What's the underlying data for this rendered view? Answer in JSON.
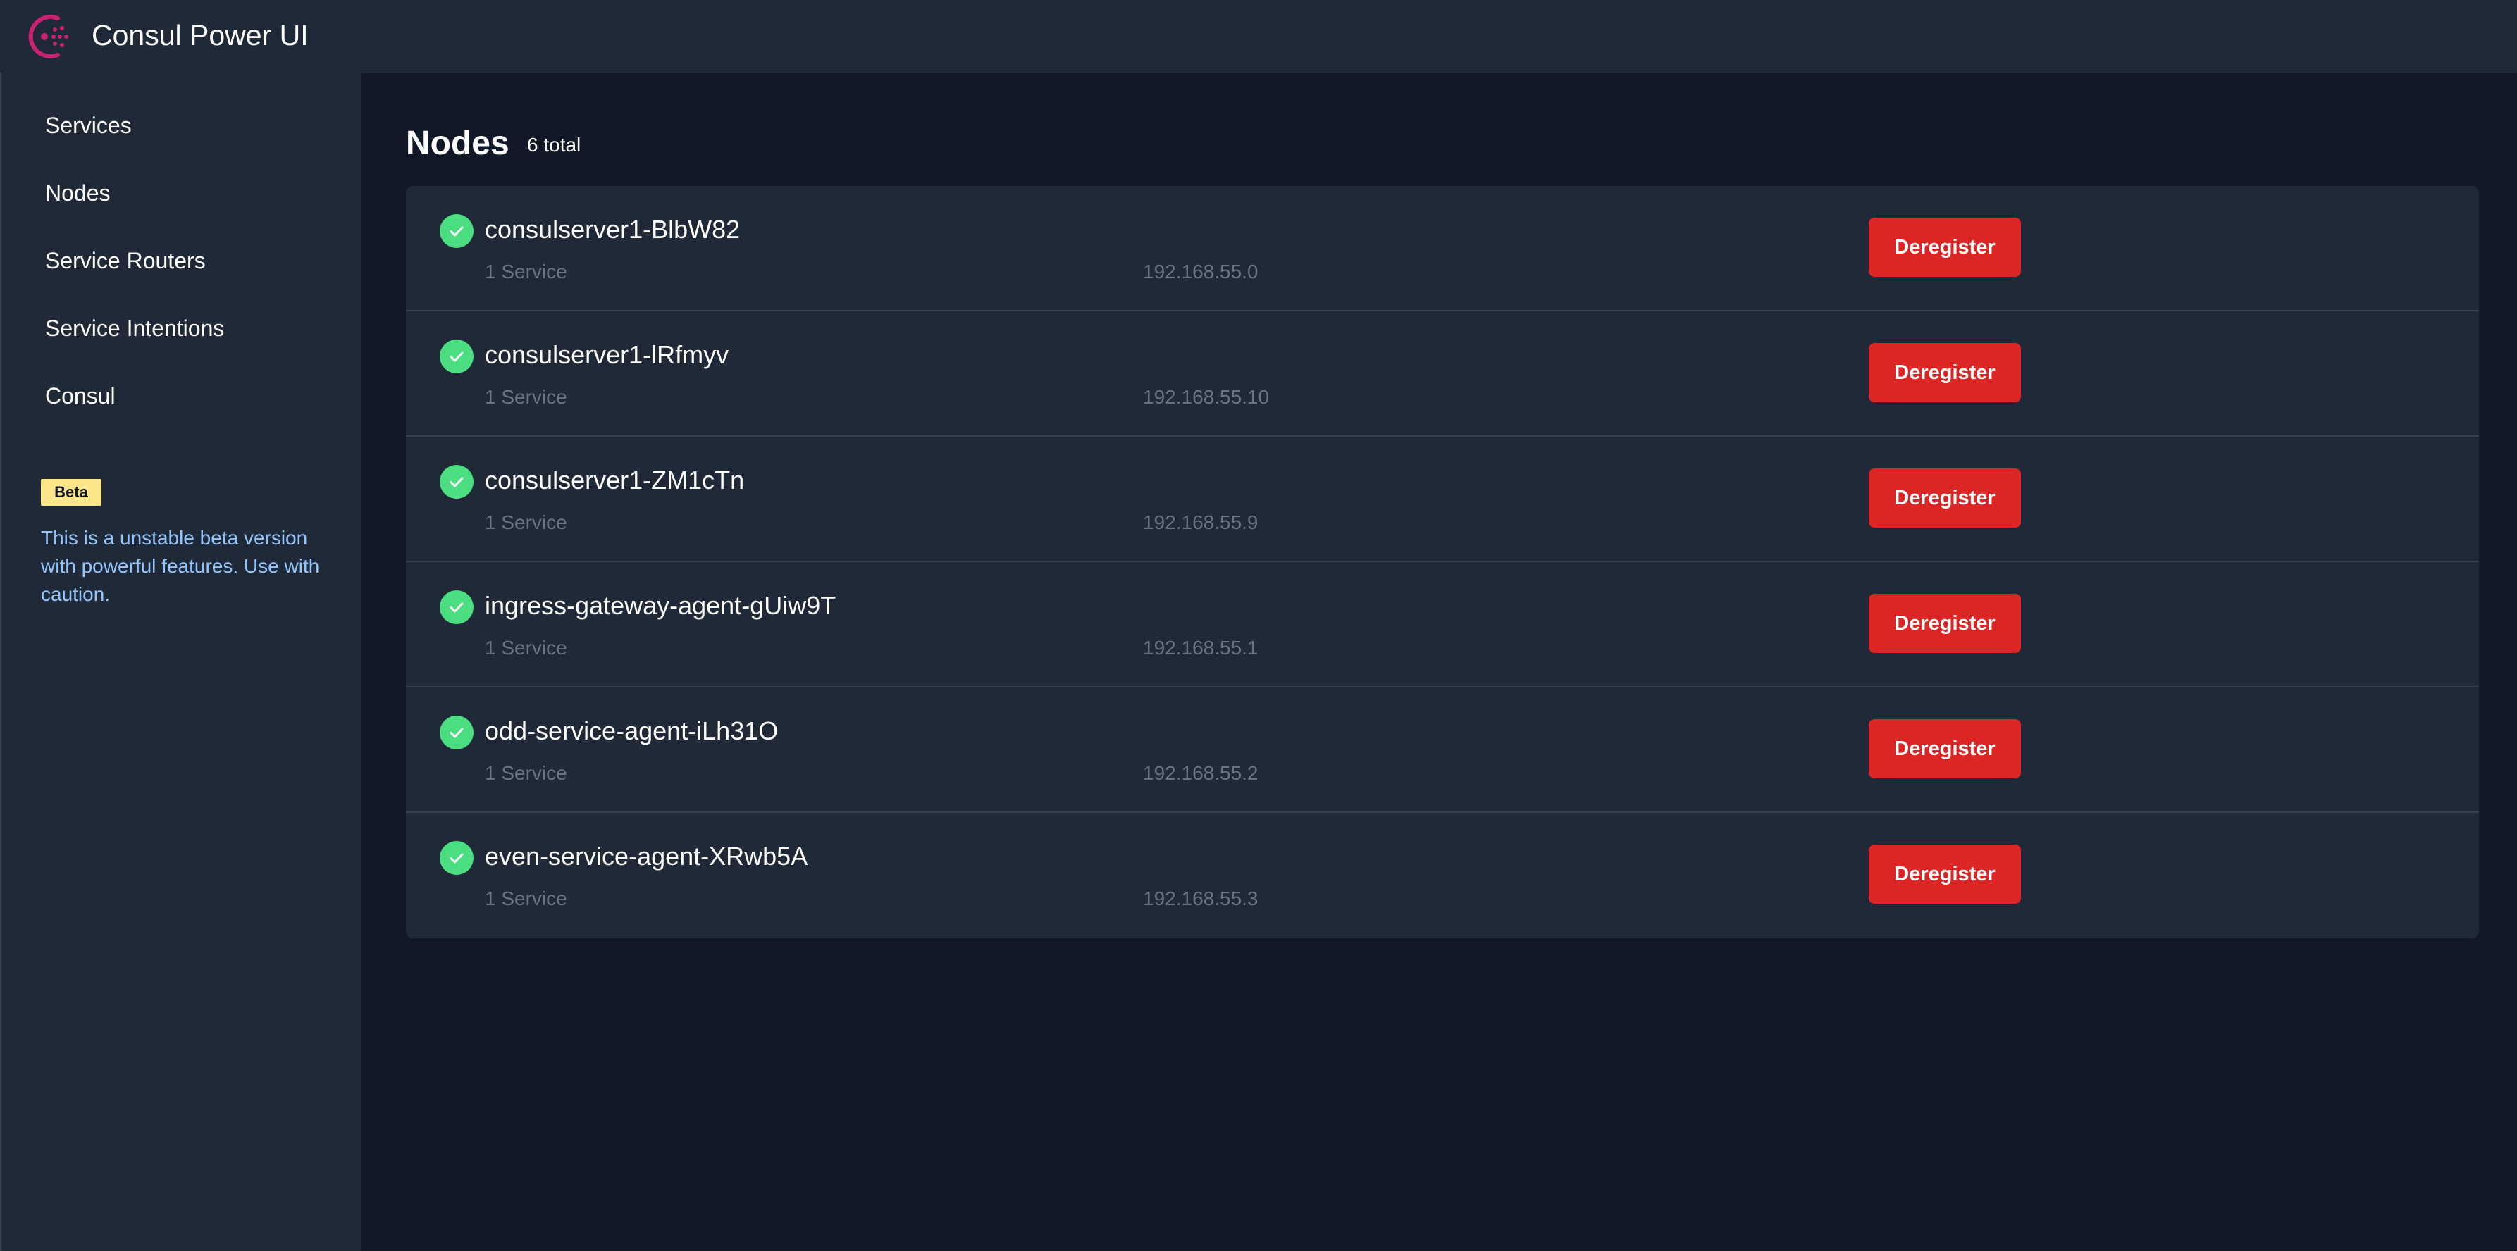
{
  "app": {
    "title": "Consul Power UI"
  },
  "sidebar": {
    "items": [
      {
        "label": "Services"
      },
      {
        "label": "Nodes"
      },
      {
        "label": "Service Routers"
      },
      {
        "label": "Service Intentions"
      },
      {
        "label": "Consul"
      }
    ],
    "beta": {
      "badge": "Beta",
      "text": "This is a unstable beta version with powerful features. Use with caution."
    }
  },
  "page": {
    "title": "Nodes",
    "total": "6 total"
  },
  "nodes": [
    {
      "name": "consulserver1-BlbW82",
      "services": "1 Service",
      "address": "192.168.55.0",
      "action": "Deregister",
      "status_icon": "check-circle-icon"
    },
    {
      "name": "consulserver1-lRfmyv",
      "services": "1 Service",
      "address": "192.168.55.10",
      "action": "Deregister",
      "status_icon": "check-circle-icon"
    },
    {
      "name": "consulserver1-ZM1cTn",
      "services": "1 Service",
      "address": "192.168.55.9",
      "action": "Deregister",
      "status_icon": "check-circle-icon"
    },
    {
      "name": "ingress-gateway-agent-gUiw9T",
      "services": "1 Service",
      "address": "192.168.55.1",
      "action": "Deregister",
      "status_icon": "check-circle-icon"
    },
    {
      "name": "odd-service-agent-iLh31O",
      "services": "1 Service",
      "address": "192.168.55.2",
      "action": "Deregister",
      "status_icon": "check-circle-icon"
    },
    {
      "name": "even-service-agent-XRwb5A",
      "services": "1 Service",
      "address": "192.168.55.3",
      "action": "Deregister",
      "status_icon": "check-circle-icon"
    }
  ],
  "colors": {
    "background": "#111827",
    "panel": "#1f2937",
    "accent_brand": "#ca2171",
    "status_healthy": "#4ade80",
    "danger": "#dc2626",
    "beta_badge": "#fde68a",
    "beta_text": "#93c5fd",
    "muted_text": "#6b7280"
  }
}
